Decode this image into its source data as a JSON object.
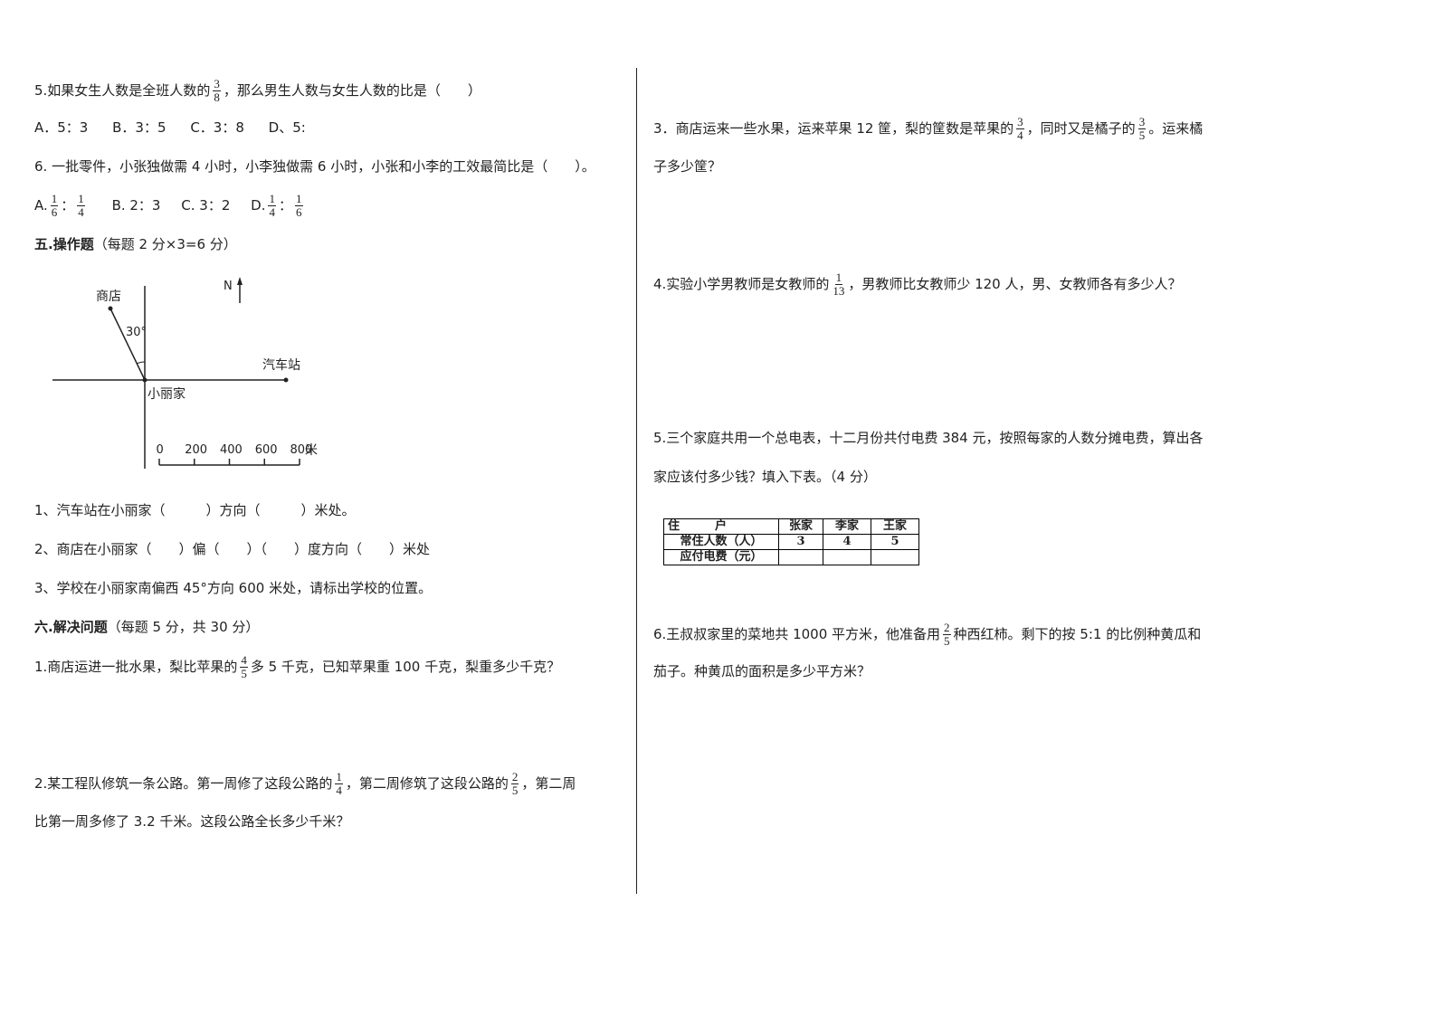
{
  "left": {
    "q5": {
      "text_a": "5.如果女生人数是全班人数的",
      "frac": {
        "num": "3",
        "den": "8"
      },
      "text_b": "，那么男生人数与女生人数的比是（　　）",
      "options": [
        "A．5：3",
        "B．3：5",
        "C．3：8",
        "D、5:"
      ]
    },
    "q6": {
      "text": "6. 一批零件，小张独做需 4 小时，小李独做需 6 小时，小张和小李的工效最简比是（　　）。",
      "opt_a_label": "A.",
      "opt_a_frac1": {
        "num": "1",
        "den": "6"
      },
      "opt_a_frac2": {
        "num": "1",
        "den": "4"
      },
      "opt_b": "B. 2：3",
      "opt_c": "C. 3：2",
      "opt_d_label": "D.",
      "opt_d_frac1": {
        "num": "1",
        "den": "4"
      },
      "opt_d_frac2": {
        "num": "1",
        "den": "6"
      },
      "colon": "："
    },
    "section5": {
      "title": "五.操作题",
      "score": "（每题 2 分×3=6 分）"
    },
    "map": {
      "north_label": "N",
      "shop_label": "商店",
      "angle_label": "30°",
      "bus_station_label": "汽车站",
      "home_label": "小丽家",
      "scale_ticks": [
        "0",
        "200",
        "400",
        "600",
        "800"
      ],
      "scale_unit": "米",
      "shop_bearing_deg": 30,
      "bus_station_distance_m": 800
    },
    "ops": [
      "1、汽车站在小丽家（　　　）方向（　　　）米处。",
      "2、商店在小丽家（　　）偏（　　）（　　）度方向（　　）米处",
      "3、学校在小丽家南偏西 45°方向 600 米处，请标出学校的位置。"
    ],
    "section6": {
      "title": "六.解决问题",
      "score": "（每题 5 分，共 30 分）"
    },
    "p1": {
      "text_a": "1.商店运进一批水果，梨比苹果的",
      "frac": {
        "num": "4",
        "den": "5"
      },
      "text_b": "多 5 千克，已知苹果重 100 千克，梨重多少千克？"
    },
    "p2": {
      "text_a": "2.某工程队修筑一条公路。第一周修了这段公路的",
      "frac1": {
        "num": "1",
        "den": "4"
      },
      "text_b": "，第二周修筑了这段公路的",
      "frac2": {
        "num": "2",
        "den": "5"
      },
      "text_c": "，第二周",
      "line2": "比第一周多修了 3.2 千米。这段公路全长多少千米？"
    }
  },
  "right": {
    "p3": {
      "text_a": "3．商店运来一些水果，运来苹果 12 筐，梨的筐数是苹果的",
      "frac1": {
        "num": "3",
        "den": "4"
      },
      "text_b": "，同时又是橘子的",
      "frac2": {
        "num": "3",
        "den": "5"
      },
      "text_c": "。运来橘",
      "line2": "子多少筐？"
    },
    "p4": {
      "text_a": "4.实验小学男教师是女教师的",
      "frac": {
        "num": "1",
        "den": "13"
      },
      "text_b": "，男教师比女教师少 120 人，男、女教师各有多少人？"
    },
    "p5": {
      "line1": "5.三个家庭共用一个总电表，十二月份共付电费 384 元，按照每家的人数分摊电费，算出各",
      "line2": "家应该付多少钱？填入下表。（4 分）",
      "table": {
        "header": [
          "住　　　户",
          "张家",
          "李家",
          "王家"
        ],
        "rows": [
          [
            "常住人数（人）",
            "3",
            "4",
            "5"
          ],
          [
            "应付电费（元）",
            "",
            "",
            ""
          ]
        ]
      }
    },
    "p6": {
      "text_a": "6.王叔叔家里的菜地共 1000 平方米，他准备用",
      "frac": {
        "num": "2",
        "den": "5"
      },
      "text_b": "种西红柿。剩下的按 5:1 的比例种黄瓜和",
      "line2": "茄子。种黄瓜的面积是多少平方米？"
    }
  }
}
